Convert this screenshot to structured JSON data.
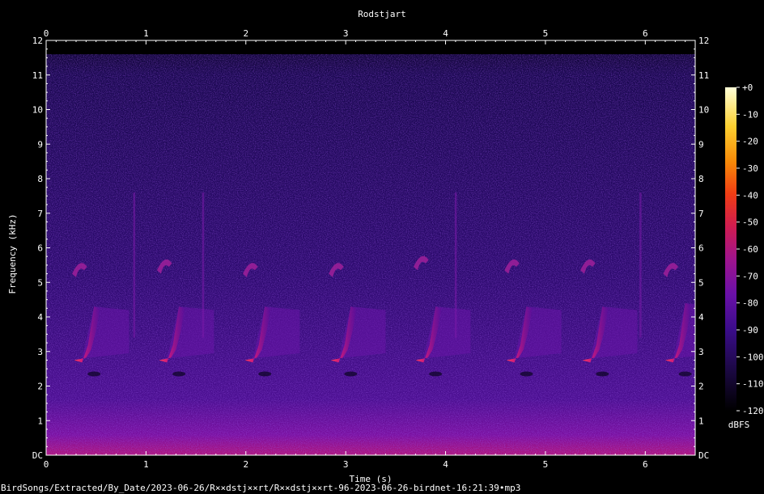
{
  "chart_data": {
    "type": "heatmap",
    "title": "Rodstjart",
    "xlabel": "Time (s)",
    "ylabel": "Frequency (kHz)",
    "xlim": [
      0,
      6.5
    ],
    "ylim": [
      0,
      12
    ],
    "x_ticks": [
      "0",
      "1",
      "2",
      "3",
      "4",
      "5",
      "6"
    ],
    "y_ticks": [
      "DC",
      "1",
      "2",
      "3",
      "4",
      "5",
      "6",
      "7",
      "8",
      "9",
      "10",
      "11",
      "12"
    ],
    "colorbar": {
      "unit": "dBFS",
      "range": [
        -120,
        0
      ],
      "ticks": [
        "+0",
        "-10",
        "-20",
        "-30",
        "-40",
        "-50",
        "-60",
        "-70",
        "-80",
        "-90",
        "-100",
        "-110",
        "-120"
      ],
      "colormap": [
        "#000000",
        "#1a0840",
        "#3a0c8a",
        "#6a10a8",
        "#a0148c",
        "#d01c50",
        "#f03c14",
        "#f88a08",
        "#fcd030",
        "#ffffd8"
      ]
    },
    "recording_cutoff_khz": 11.6,
    "calls": [
      {
        "start_s": 0.28,
        "main_band_khz": [
          2.7,
          4.3
        ],
        "upper_note_khz": 5.4
      },
      {
        "start_s": 1.13,
        "main_band_khz": [
          2.7,
          4.3
        ],
        "upper_note_khz": 5.5
      },
      {
        "start_s": 1.99,
        "main_band_khz": [
          2.7,
          4.3
        ],
        "upper_note_khz": 5.4
      },
      {
        "start_s": 2.85,
        "main_band_khz": [
          2.7,
          4.3
        ],
        "upper_note_khz": 5.4
      },
      {
        "start_s": 3.7,
        "main_band_khz": [
          2.7,
          4.3
        ],
        "upper_note_khz": 5.6
      },
      {
        "start_s": 4.61,
        "main_band_khz": [
          2.7,
          4.3
        ],
        "upper_note_khz": 5.5
      },
      {
        "start_s": 5.37,
        "main_band_khz": [
          2.7,
          4.3
        ],
        "upper_note_khz": 5.5
      },
      {
        "start_s": 6.2,
        "main_band_khz": [
          2.7,
          4.4
        ],
        "upper_note_khz": 5.4
      }
    ],
    "clicks_s": [
      0.88,
      1.57,
      4.1,
      5.95
    ]
  },
  "footer": {
    "file_path": "BirdSongs/Extracted/By_Date/2023-06-26/R××dstj××rt/R××dstj××rt-96-2023-06-26-birdnet-16:21:39•mp3"
  }
}
